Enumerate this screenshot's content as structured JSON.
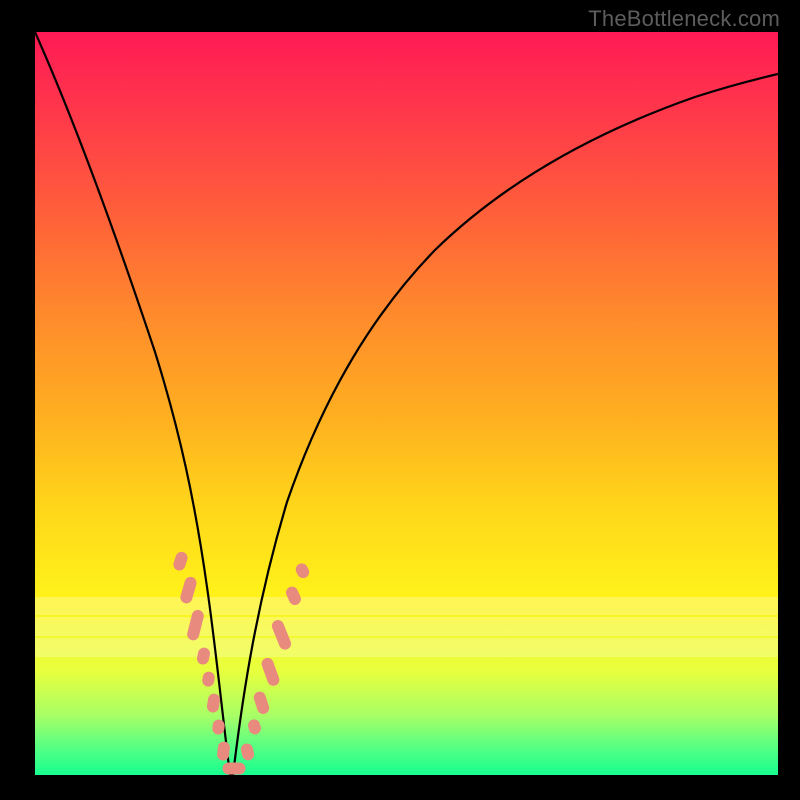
{
  "attribution": "TheBottleneck.com",
  "colors": {
    "frame": "#000000",
    "curve_stroke": "#000000",
    "marker_fill": "#e88a7e",
    "gradient_stops": [
      "#ff1a55",
      "#ff6438",
      "#ffd61a",
      "#17ff8f"
    ]
  },
  "chart_data": {
    "type": "line",
    "title": "",
    "xlabel": "",
    "ylabel": "",
    "xlim": [
      0,
      100
    ],
    "ylim": [
      0,
      100
    ],
    "grid": false,
    "legend": false,
    "series": [
      {
        "name": "bottleneck-curve",
        "x": [
          0,
          4,
          8,
          12,
          16,
          18,
          20,
          22,
          24,
          26,
          28,
          30,
          34,
          38,
          42,
          46,
          52,
          60,
          70,
          82,
          94,
          100
        ],
        "y": [
          100,
          86,
          72,
          58,
          44,
          37,
          27,
          17,
          7,
          0,
          5,
          14,
          28,
          40,
          50,
          58,
          66,
          74,
          81,
          86,
          90,
          92
        ]
      }
    ],
    "markers": {
      "name": "highlighted-points",
      "shape": "rounded",
      "x": [
        19.5,
        20.3,
        21.0,
        22.0,
        22.7,
        23.5,
        24.3,
        25.3,
        26.4,
        27.2,
        28.2,
        29.2,
        30.2,
        31.2,
        32.0
      ],
      "y": [
        29,
        27,
        24,
        17,
        13,
        9,
        6,
        2,
        0,
        3,
        8,
        13,
        18,
        23,
        26
      ]
    },
    "pale_bands_y": [
      76,
      78.8,
      81.6
    ]
  }
}
